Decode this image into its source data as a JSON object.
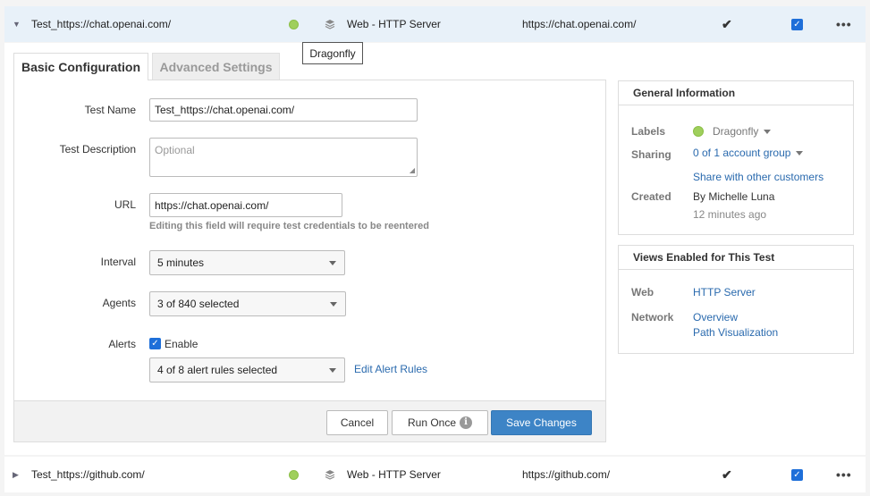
{
  "rows": [
    {
      "name": "Test_https://chat.openai.com/",
      "type": "Web - HTTP Server",
      "url": "https://chat.openai.com/",
      "expanded": true
    },
    {
      "name": "Test_https://github.com/",
      "type": "Web - HTTP Server",
      "url": "https://github.com/",
      "expanded": false
    }
  ],
  "tooltip": "Dragonfly",
  "tabs": {
    "basic": "Basic Configuration",
    "advanced": "Advanced Settings"
  },
  "form": {
    "test_name_label": "Test Name",
    "test_name_value": "Test_https://chat.openai.com/",
    "description_label": "Test Description",
    "description_placeholder": "Optional",
    "url_label": "URL",
    "url_value": "https://chat.openai.com/",
    "url_helper": "Editing this field will require test credentials to be reentered",
    "interval_label": "Interval",
    "interval_value": "5 minutes",
    "agents_label": "Agents",
    "agents_value": "3 of 840 selected",
    "alerts_label": "Alerts",
    "alerts_enable": "Enable",
    "alert_rules_value": "4 of 8 alert rules selected",
    "edit_alert_rules": "Edit Alert Rules"
  },
  "buttons": {
    "cancel": "Cancel",
    "run_once": "Run Once",
    "save": "Save Changes"
  },
  "general_info": {
    "title": "General Information",
    "labels_key": "Labels",
    "labels_value": "Dragonfly",
    "sharing_key": "Sharing",
    "sharing_value": "0 of 1 account group",
    "share_link": "Share with other customers",
    "created_key": "Created",
    "created_by": "By Michelle Luna",
    "created_ago": "12 minutes ago"
  },
  "views": {
    "title": "Views Enabled for This Test",
    "web_key": "Web",
    "web_value": "HTTP Server",
    "network_key": "Network",
    "network_overview": "Overview",
    "network_path": "Path Visualization"
  },
  "colors": {
    "accent": "#3d84c6",
    "link": "#2a6aae",
    "status_dot": "#9fcf5c",
    "row_highlight": "#e8f1f9"
  }
}
